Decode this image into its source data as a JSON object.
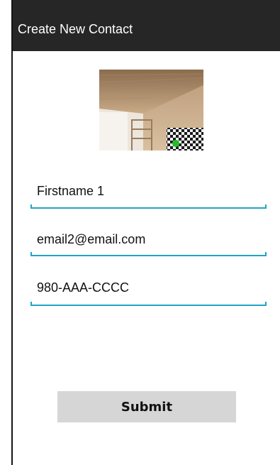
{
  "action_bar": {
    "title": "Create New Contact"
  },
  "photo": {
    "icon": "contact-photo-image"
  },
  "form": {
    "firstname_value": "Firstname 1",
    "email_value": "email2@email.com",
    "phone_value": "980-AAA-CCCC"
  },
  "submit_label": "Submit",
  "colors": {
    "action_bar_bg": "#262626",
    "field_underline": "#1fa4c8",
    "button_bg": "#d6d6d6"
  }
}
